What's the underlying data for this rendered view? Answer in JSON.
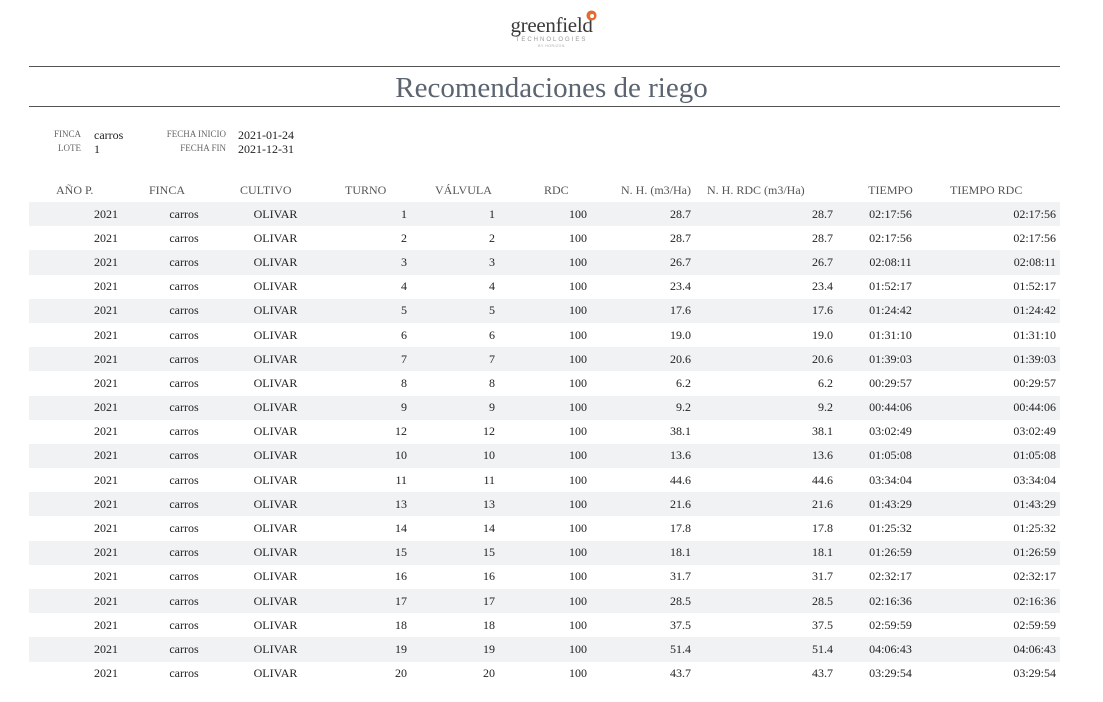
{
  "logo": {
    "word": "greenfield",
    "sub": "TECHNOLOGIES",
    "sub2": "BY HORIZON",
    "accent": "#e36b2c"
  },
  "title": "Recomendaciones de riego",
  "meta": {
    "finca_label": "FINCA",
    "finca_value": "carros",
    "lote_label": "LOTE",
    "lote_value": "1",
    "fecha_inicio_label": "FECHA INICIO",
    "fecha_inicio_value": "2021-01-24",
    "fecha_fin_label": "FECHA FIN",
    "fecha_fin_value": "2021-12-31"
  },
  "table": {
    "headers": [
      "AÑO P.",
      "FINCA",
      "CULTIVO",
      "TURNO",
      "VÁLVULA",
      "RDC",
      "N. H. (m3/Ha)",
      "N. H. RDC (m3/Ha)",
      "TIEMPO",
      "TIEMPO RDC"
    ],
    "rows": [
      [
        "2021",
        "carros",
        "OLIVAR",
        "1",
        "1",
        "100",
        "28.7",
        "28.7",
        "02:17:56",
        "02:17:56"
      ],
      [
        "2021",
        "carros",
        "OLIVAR",
        "2",
        "2",
        "100",
        "28.7",
        "28.7",
        "02:17:56",
        "02:17:56"
      ],
      [
        "2021",
        "carros",
        "OLIVAR",
        "3",
        "3",
        "100",
        "26.7",
        "26.7",
        "02:08:11",
        "02:08:11"
      ],
      [
        "2021",
        "carros",
        "OLIVAR",
        "4",
        "4",
        "100",
        "23.4",
        "23.4",
        "01:52:17",
        "01:52:17"
      ],
      [
        "2021",
        "carros",
        "OLIVAR",
        "5",
        "5",
        "100",
        "17.6",
        "17.6",
        "01:24:42",
        "01:24:42"
      ],
      [
        "2021",
        "carros",
        "OLIVAR",
        "6",
        "6",
        "100",
        "19.0",
        "19.0",
        "01:31:10",
        "01:31:10"
      ],
      [
        "2021",
        "carros",
        "OLIVAR",
        "7",
        "7",
        "100",
        "20.6",
        "20.6",
        "01:39:03",
        "01:39:03"
      ],
      [
        "2021",
        "carros",
        "OLIVAR",
        "8",
        "8",
        "100",
        "6.2",
        "6.2",
        "00:29:57",
        "00:29:57"
      ],
      [
        "2021",
        "carros",
        "OLIVAR",
        "9",
        "9",
        "100",
        "9.2",
        "9.2",
        "00:44:06",
        "00:44:06"
      ],
      [
        "2021",
        "carros",
        "OLIVAR",
        "12",
        "12",
        "100",
        "38.1",
        "38.1",
        "03:02:49",
        "03:02:49"
      ],
      [
        "2021",
        "carros",
        "OLIVAR",
        "10",
        "10",
        "100",
        "13.6",
        "13.6",
        "01:05:08",
        "01:05:08"
      ],
      [
        "2021",
        "carros",
        "OLIVAR",
        "11",
        "11",
        "100",
        "44.6",
        "44.6",
        "03:34:04",
        "03:34:04"
      ],
      [
        "2021",
        "carros",
        "OLIVAR",
        "13",
        "13",
        "100",
        "21.6",
        "21.6",
        "01:43:29",
        "01:43:29"
      ],
      [
        "2021",
        "carros",
        "OLIVAR",
        "14",
        "14",
        "100",
        "17.8",
        "17.8",
        "01:25:32",
        "01:25:32"
      ],
      [
        "2021",
        "carros",
        "OLIVAR",
        "15",
        "15",
        "100",
        "18.1",
        "18.1",
        "01:26:59",
        "01:26:59"
      ],
      [
        "2021",
        "carros",
        "OLIVAR",
        "16",
        "16",
        "100",
        "31.7",
        "31.7",
        "02:32:17",
        "02:32:17"
      ],
      [
        "2021",
        "carros",
        "OLIVAR",
        "17",
        "17",
        "100",
        "28.5",
        "28.5",
        "02:16:36",
        "02:16:36"
      ],
      [
        "2021",
        "carros",
        "OLIVAR",
        "18",
        "18",
        "100",
        "37.5",
        "37.5",
        "02:59:59",
        "02:59:59"
      ],
      [
        "2021",
        "carros",
        "OLIVAR",
        "19",
        "19",
        "100",
        "51.4",
        "51.4",
        "04:06:43",
        "04:06:43"
      ],
      [
        "2021",
        "carros",
        "OLIVAR",
        "20",
        "20",
        "100",
        "43.7",
        "43.7",
        "03:29:54",
        "03:29:54"
      ]
    ]
  }
}
